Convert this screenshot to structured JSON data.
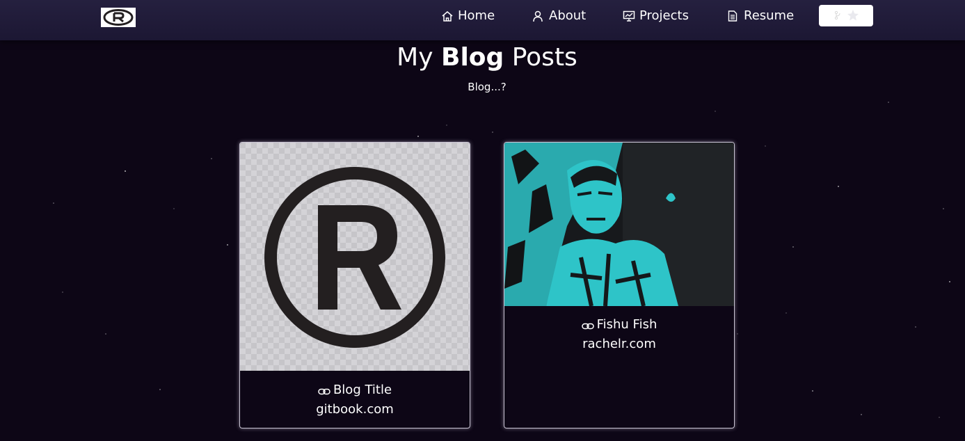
{
  "nav": {
    "logo_icon": "registered-trademark-icon",
    "items": [
      {
        "label": "Home",
        "icon": "home-icon"
      },
      {
        "label": "About",
        "icon": "user-icon"
      },
      {
        "label": "Projects",
        "icon": "presentation-icon"
      },
      {
        "label": "Resume",
        "icon": "document-icon"
      }
    ],
    "github_button": {
      "icons": [
        "git-fork-icon",
        "star-icon"
      ]
    }
  },
  "header": {
    "title_prefix": "My",
    "title_bold": "Blog",
    "title_suffix": "Posts",
    "subtitle": "Blog...?"
  },
  "posts": [
    {
      "title": "Blog Title",
      "domain": "gitbook.com",
      "image": "registered-trademark-logo",
      "link_icon": "link-icon"
    },
    {
      "title": "Fishu Fish",
      "domain": "rachelr.com",
      "image": "teal-portrait-photo",
      "link_icon": "link-icon"
    }
  ],
  "colors": {
    "background": "#0d0616",
    "navbar": "#1c1733",
    "text": "#ffffff",
    "card_border": "#c9c4d3",
    "photo_teal": "#2ec4c8"
  }
}
